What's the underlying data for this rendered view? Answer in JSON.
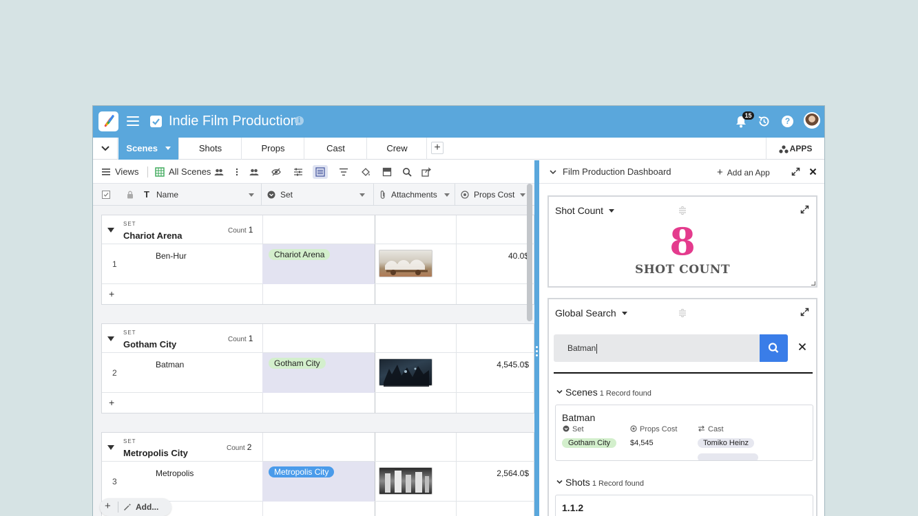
{
  "app": {
    "title": "Indie Film Production",
    "notifications": "15"
  },
  "tabs": {
    "active": "Scenes",
    "items": [
      "Shots",
      "Props",
      "Cast",
      "Crew"
    ],
    "apps_label": "APPS"
  },
  "toolbar": {
    "views_label": "Views",
    "view_name": "All Scenes"
  },
  "columns": {
    "name": "Name",
    "set": "Set",
    "attachments": "Attachments",
    "props_cost": "Props Cost"
  },
  "groups": [
    {
      "set_label": "SET",
      "name": "Chariot Arena",
      "count_label": "Count",
      "count": "1",
      "row": {
        "num": "1",
        "name": "Ben-Hur",
        "set": "Chariot Arena",
        "cost": "40.0$"
      }
    },
    {
      "set_label": "SET",
      "name": "Gotham City",
      "count_label": "Count",
      "count": "1",
      "row": {
        "num": "2",
        "name": "Batman",
        "set": "Gotham City",
        "cost": "4,545.0$"
      }
    },
    {
      "set_label": "SET",
      "name": "Metropolis City",
      "count_label": "Count",
      "count": "2",
      "row": {
        "num": "3",
        "name": "Metropolis",
        "set": "Metropolis City",
        "cost": "2,564.0$"
      }
    }
  ],
  "add_bar": {
    "label": "Add..."
  },
  "dashboard": {
    "title": "Film Production Dashboard",
    "add_app_label": "Add an App",
    "shot_count": {
      "title": "Shot Count",
      "value": "8",
      "label": "SHOT COUNT"
    },
    "global_search": {
      "title": "Global Search",
      "query": "Batman",
      "scenes": {
        "heading": "Scenes",
        "found": "1 Record found",
        "record": {
          "name": "Batman",
          "set_label": "Set",
          "set_value": "Gotham City",
          "props_label": "Props Cost",
          "props_value": "$4,545",
          "cast_label": "Cast",
          "cast_value": "Tomiko Heinz"
        }
      },
      "shots": {
        "heading": "Shots",
        "found": "1 Record found",
        "record": {
          "name": "1.1.2"
        }
      }
    }
  },
  "colors": {
    "brand": "#5aa7dc",
    "accent_pink": "#e43b8d",
    "search_blue": "#3a7de8"
  }
}
